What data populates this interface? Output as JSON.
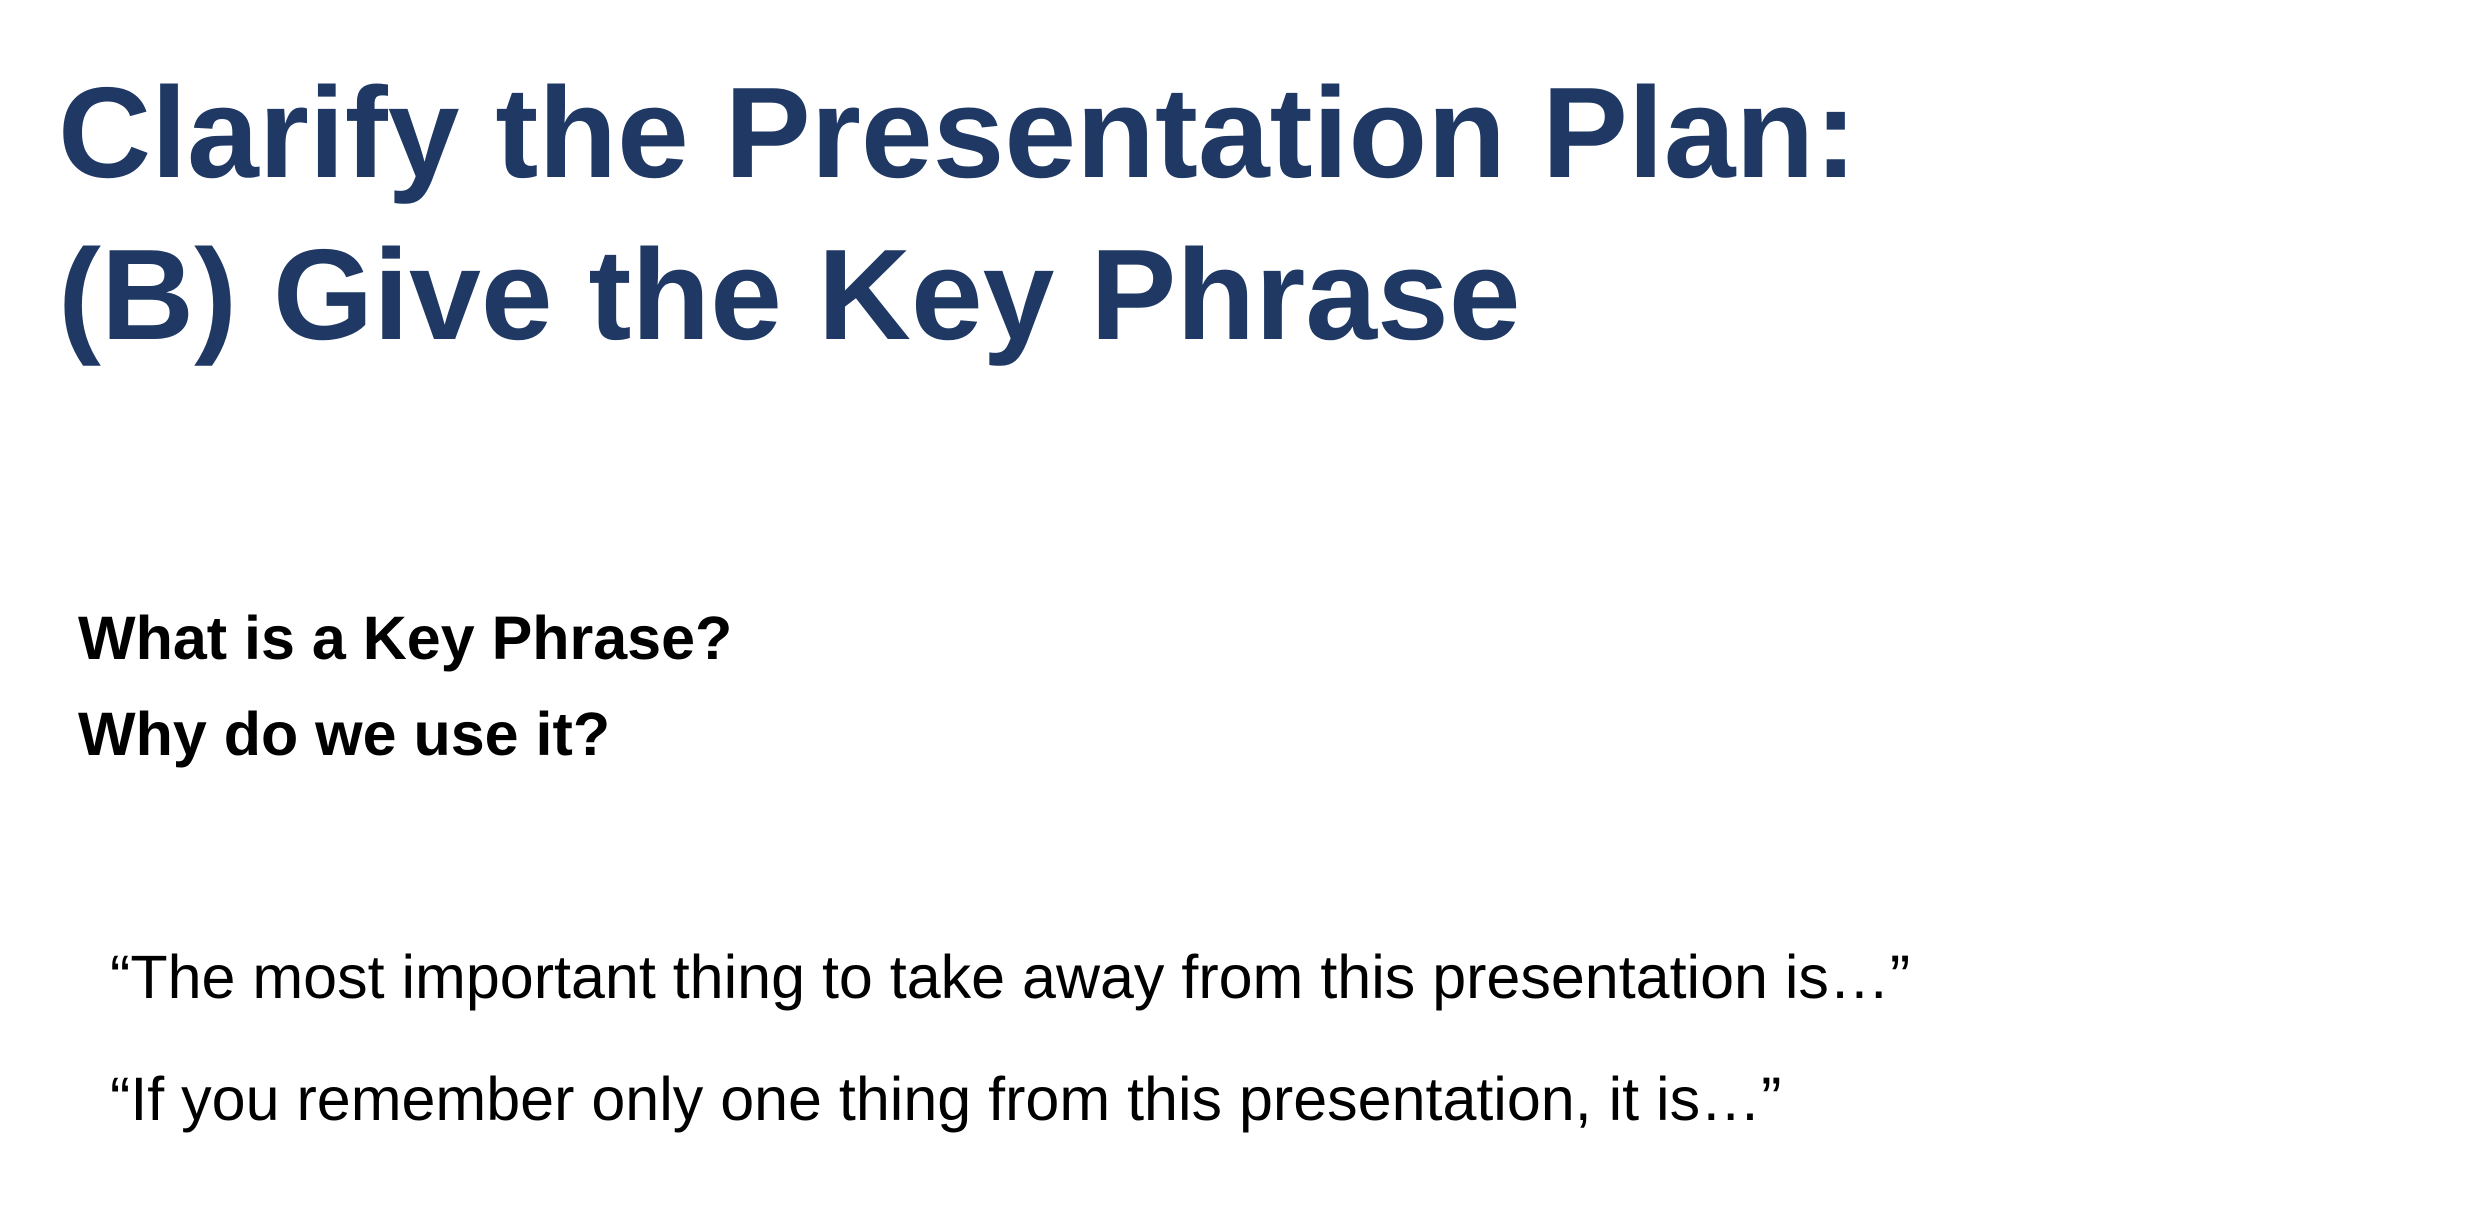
{
  "slide": {
    "title_lines": [
      "Clarify the Presentation Plan:",
      "(B) Give the Key Phrase"
    ],
    "questions": [
      "What is a Key Phrase?",
      "Why do we use it?"
    ],
    "example_phrases": [
      "“The most important thing to take away from this presentation is…”",
      "“If you remember only one thing from this presentation, it is…”"
    ]
  },
  "colors": {
    "title": "#1f3864",
    "body_text": "#000000",
    "background": "#ffffff"
  }
}
